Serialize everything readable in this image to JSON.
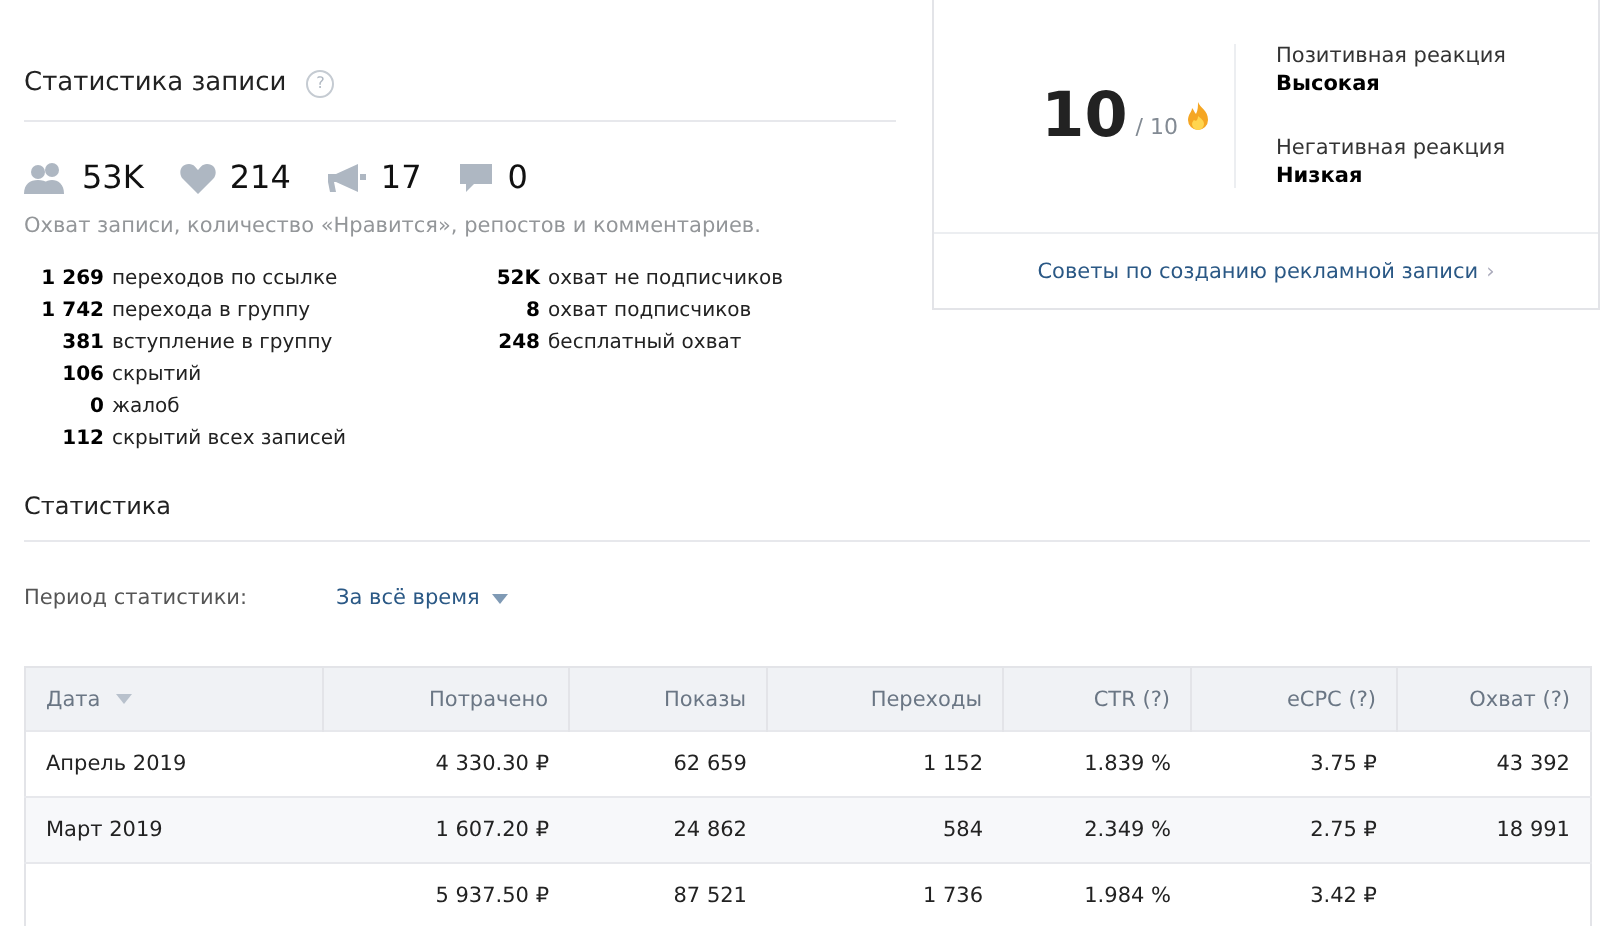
{
  "post_stats": {
    "title": "Статистика записи",
    "help": "?",
    "counters": [
      {
        "kind": "reach",
        "value": "53K"
      },
      {
        "kind": "likes",
        "value": "214"
      },
      {
        "kind": "reposts",
        "value": "17"
      },
      {
        "kind": "comments",
        "value": "0"
      }
    ],
    "caption": "Охват записи, количество «Нравится», репостов и комментариев.",
    "left_items": [
      {
        "count": "1 269",
        "description": "переходов по ссылке"
      },
      {
        "count": "1 742",
        "description": "перехода в группу"
      },
      {
        "count": "381",
        "description": "вступление в группу"
      },
      {
        "count": "106",
        "description": "скрытий"
      },
      {
        "count": "0",
        "description": "жалоб"
      },
      {
        "count": "112",
        "description": "скрытий всех записей"
      }
    ],
    "right_items": [
      {
        "count": "52K",
        "description": "охват не подписчиков"
      },
      {
        "count": "8",
        "description": "охват подписчиков"
      },
      {
        "count": "248",
        "description": "бесплатный охват"
      }
    ]
  },
  "score_card": {
    "score": "10",
    "max": "/ 10",
    "reactions": [
      {
        "label": "Позитивная реакция",
        "value": "Высокая"
      },
      {
        "label": "Негативная реакция",
        "value": "Низкая"
      }
    ],
    "tips_link": "Советы по созданию рекламной записи",
    "tips_chevron": "›"
  },
  "statistics": {
    "title": "Статистика",
    "period_label": "Период статистики:",
    "period_value": "За всё время",
    "columns": [
      {
        "label": "Дата",
        "sortable": true
      },
      {
        "label": "Потрачено",
        "sortable": false
      },
      {
        "label": "Показы",
        "sortable": false
      },
      {
        "label": "Переходы",
        "sortable": false
      },
      {
        "label": "CTR (?)",
        "sortable": false
      },
      {
        "label": "eCPC (?)",
        "sortable": false
      },
      {
        "label": "Охват (?)",
        "sortable": false
      }
    ],
    "rows": [
      {
        "cells": [
          "Апрель 2019",
          "4 330.30 ₽",
          "62 659",
          "1 152",
          "1.839 %",
          "3.75 ₽",
          "43 392"
        ]
      },
      {
        "cells": [
          "Март 2019",
          "1 607.20 ₽",
          "24 862",
          "584",
          "2.349 %",
          "2.75 ₽",
          "18 991"
        ]
      },
      {
        "cells": [
          "",
          "5 937.50 ₽",
          "87 521",
          "1 736",
          "1.984 %",
          "3.42 ₽",
          ""
        ]
      }
    ]
  }
}
